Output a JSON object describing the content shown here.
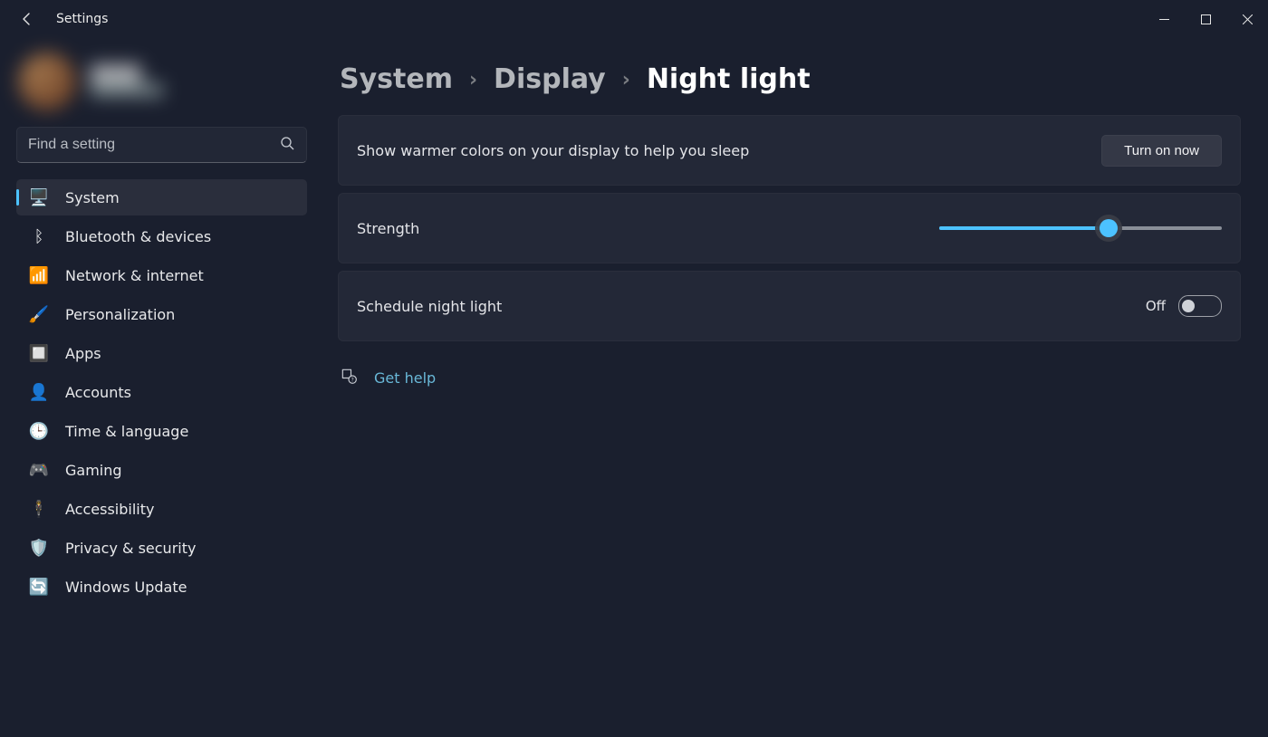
{
  "app_title": "Settings",
  "search_placeholder": "Find a setting",
  "breadcrumb": {
    "items": [
      "System",
      "Display",
      "Night light"
    ]
  },
  "sidebar": {
    "items": [
      {
        "icon": "🖥️",
        "label": "System",
        "active": true
      },
      {
        "icon": "ᛒ",
        "label": "Bluetooth & devices"
      },
      {
        "icon": "📶",
        "label": "Network & internet"
      },
      {
        "icon": "🖌️",
        "label": "Personalization"
      },
      {
        "icon": "🔲",
        "label": "Apps"
      },
      {
        "icon": "👤",
        "label": "Accounts"
      },
      {
        "icon": "🕒",
        "label": "Time & language"
      },
      {
        "icon": "🎮",
        "label": "Gaming"
      },
      {
        "icon": "🕴️",
        "label": "Accessibility"
      },
      {
        "icon": "🛡️",
        "label": "Privacy & security"
      },
      {
        "icon": "🔄",
        "label": "Windows Update"
      }
    ]
  },
  "cards": {
    "description": "Show warmer colors on your display to help you sleep",
    "turn_on_label": "Turn on now",
    "strength_label": "Strength",
    "strength_percent": 60,
    "schedule_label": "Schedule night light",
    "schedule_state_text": "Off",
    "schedule_on": false
  },
  "help": {
    "label": "Get help"
  },
  "colors": {
    "accent": "#4cc2ff",
    "link": "#69b8d8"
  }
}
